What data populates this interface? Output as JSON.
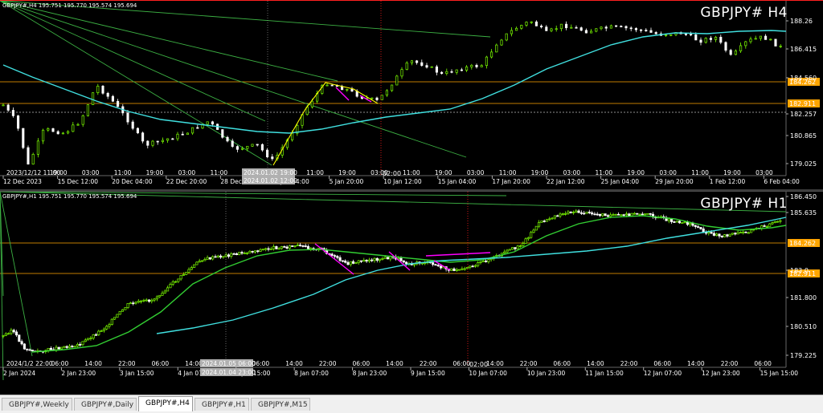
{
  "top": {
    "info": "GBPJPY#,H4  195.751 195.770 195.574 195.694",
    "big_label": "GBPJPY# H4",
    "price_ticks": [
      "188.26",
      "186.415",
      "184.560",
      "182.257",
      "180.865",
      "179.025"
    ],
    "price_tags": [
      {
        "label": "184.262",
        "color": "#ffa500"
      },
      {
        "label": "182.911",
        "color": "#ffa500"
      }
    ],
    "time_ticks": [
      "12 Dec 2023",
      "15 Dec 12:00",
      "20 Dec 04:00",
      "22 Dec 20:00",
      "28 Dec 12:00",
      "3 Jan 04:00",
      "5 Jan 20:00",
      "10 Jan 12:00",
      "15 Jan 04:00",
      "17 Jan 20:00",
      "22 Jan 12:00",
      "25 Jan 04:00",
      "29 Jan 20:00",
      "1 Feb 12:00",
      "6 Feb 04:00"
    ],
    "hour_ticks": [
      "2023/12/12 11:00",
      "19:00",
      "03:00",
      "11:00",
      "19:00",
      "03:00",
      "11:00",
      "19:00",
      "03:00",
      "11:00",
      "19:00",
      "03:00",
      "11:00",
      "19:00",
      "03:00",
      "11:00",
      "19:00",
      "03:00",
      "11:00",
      "19:00",
      "03:00",
      "11:00",
      "19:00",
      "03:00"
    ],
    "crosshair_time_a": "2024.01.02 19:00",
    "crosshair_time_b": "2024.01.02 12:00",
    "crosshair_label": "02:00"
  },
  "bottom": {
    "info": "GBPJPY#,H1  195.751 195.770 195.574 195.694",
    "big_label": "GBPJPY# H1",
    "price_ticks": [
      "186.450",
      "185.635",
      "183.0",
      "181.800",
      "180.510",
      "179.225"
    ],
    "price_tags": [
      {
        "label": "184.262",
        "color": "#ffa500"
      },
      {
        "label": "182.911",
        "color": "#ffa500"
      }
    ],
    "time_ticks": [
      "2 Jan 2024",
      "2 Jan 23:00",
      "3 Jan 15:00",
      "4 Jan 07:00",
      "5 Jan 15:00",
      "8 Jan 07:00",
      "8 Jan 23:00",
      "9 Jan 15:00",
      "10 Jan 07:00",
      "10 Jan 23:00",
      "11 Jan 15:00",
      "12 Jan 07:00",
      "12 Jan 23:00",
      "15 Jan 15:00"
    ],
    "hour_ticks": [
      "2024/1/2 22:00",
      "06:00",
      "14:00",
      "22:00",
      "06:00",
      "14:00",
      "22:00",
      "06:00",
      "14:00",
      "22:00",
      "06:00",
      "14:00",
      "22:00",
      "06:00",
      "14:00",
      "22:00",
      "06:00",
      "14:00",
      "22:00",
      "06:00",
      "14:00",
      "22:00",
      "06:00"
    ],
    "crosshair_time_a": "2024.01.05 06:00",
    "crosshair_time_b": "2024.01.04 23:00",
    "crosshair_label": "02:00"
  },
  "tabs": [
    {
      "label": "GBPJPY#,Weekly",
      "active": false
    },
    {
      "label": "GBPJPY#,Daily",
      "active": false
    },
    {
      "label": "GBPJPY#,H4",
      "active": true
    },
    {
      "label": "GBPJPY#,H1",
      "active": false
    },
    {
      "label": "GBPJPY#,M15",
      "active": false
    }
  ],
  "colors": {
    "bull": "#7cfc00",
    "bear": "#ffffff",
    "ma_slow": "#40e0e0",
    "ma_fast": "#32cd32",
    "hline": "#ffa500",
    "pattern": "#ff00ff",
    "crosshair": "#ff2020",
    "channel": "#3cb043",
    "swing": "#ffff00"
  }
}
